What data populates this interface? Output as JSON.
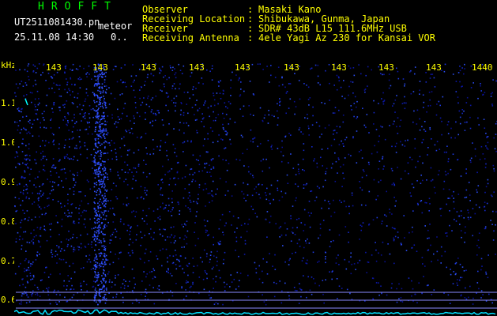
{
  "brand": "HROFFT",
  "filename": "UT2511081430.pn",
  "mode": "meteor",
  "datetime": "25.11.08 14:30",
  "counter": "0..",
  "info": [
    {
      "label": "Observer",
      "value": "Masaki Kano"
    },
    {
      "label": "Receiving Location",
      "value": "Shibukawa, Gunma, Japan"
    },
    {
      "label": "Receiver",
      "value": "SDR# 43dB L15 111.6MHz USB"
    },
    {
      "label": "Receiving Antenna",
      "value": "4ele Yagi Az 230 for Kansai VOR"
    }
  ],
  "axis": {
    "y_unit": "kHz",
    "y_ticks": [
      "1.1",
      "1.0",
      "0.9",
      "0.8",
      "0.7",
      "0.6"
    ],
    "x_ticks": [
      "143",
      "143",
      "143",
      "143",
      "143",
      "143",
      "143",
      "143",
      "143",
      "1440"
    ]
  },
  "colors": {
    "background": "#000000",
    "text": "#ffff00",
    "brand": "#00ff00",
    "noise": "#1a2cd8",
    "spectrum": "#00e0ff"
  }
}
